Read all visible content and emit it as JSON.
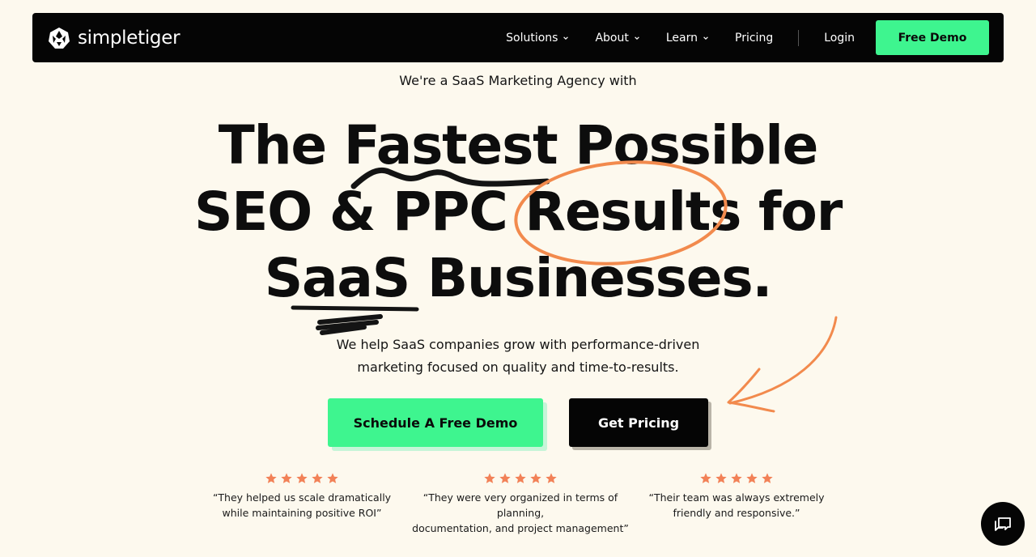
{
  "nav": {
    "logo_text": "simpletiger",
    "items": [
      {
        "label": "Solutions",
        "has_dropdown": true
      },
      {
        "label": "About",
        "has_dropdown": true
      },
      {
        "label": "Learn",
        "has_dropdown": true
      },
      {
        "label": "Pricing",
        "has_dropdown": false
      }
    ],
    "login_label": "Login",
    "demo_label": "Free Demo"
  },
  "hero": {
    "tagline": "We're a SaaS Marketing Agency with",
    "headline_line1": "The Fastest Possible",
    "headline_line2": "SEO & PPC Results for",
    "headline_line3": "SaaS Businesses.",
    "sub_line1": "We help SaaS companies grow with performance-driven",
    "sub_line2": "marketing focused on quality and time-to-results.",
    "cta_primary": "Schedule A Free Demo",
    "cta_secondary": "Get Pricing"
  },
  "reviews": [
    {
      "stars": 5,
      "line1": "“They helped us scale dramatically",
      "line2": "while maintaining positive ROI”"
    },
    {
      "stars": 5,
      "line1": "“They were very organized in terms of planning,",
      "line2": "documentation, and project management”"
    },
    {
      "stars": 5,
      "line1": "“Their team was always extremely",
      "line2": "friendly and responsive.”"
    }
  ],
  "colors": {
    "accent_green": "#3ef58f",
    "accent_orange": "#f28a4d",
    "star": "#f28157",
    "background": "#fdf9ee",
    "dark": "#050505"
  },
  "icons": {
    "logo": "tiger-head-icon",
    "dropdown": "chevron-down-icon",
    "star": "star-icon",
    "chat": "chat-bubbles-icon"
  }
}
